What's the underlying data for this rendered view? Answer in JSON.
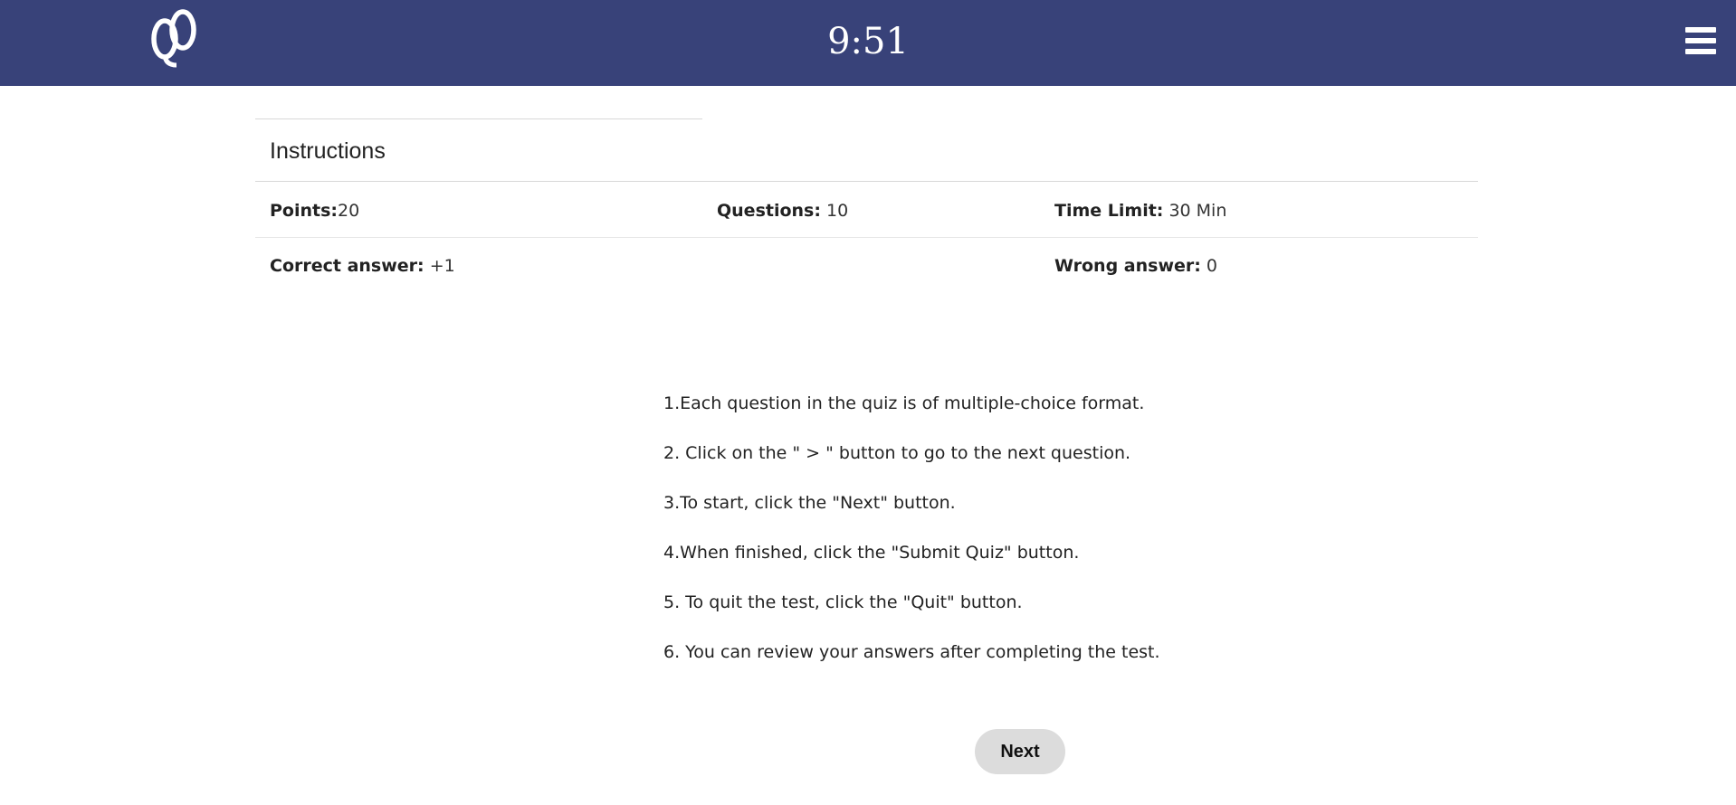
{
  "header": {
    "timer": "9:51",
    "logo_icon": "quiz-logo-icon",
    "menu_icon": "hamburger-menu-icon",
    "background_color": "#384279"
  },
  "instructions": {
    "heading": "Instructions",
    "points_label": "Points:",
    "points_value": "20",
    "questions_label": "Questions:",
    "questions_value": "10",
    "time_limit_label": "Time Limit:",
    "time_limit_value": "30 Min",
    "correct_label": "Correct answer:",
    "correct_value": "+1",
    "wrong_label": "Wrong answer:",
    "wrong_value": "0"
  },
  "rules": [
    "1.Each question in the quiz is of multiple-choice format.",
    "2. Click on the \" > \" button to go to the next question.",
    "3.To start, click the \"Next\" button.",
    "4.When finished, click the \"Submit Quiz\" button.",
    "5. To quit the test, click the \"Quit\" button.",
    "6. You can review your answers after completing the test."
  ],
  "actions": {
    "next_label": "Next"
  }
}
